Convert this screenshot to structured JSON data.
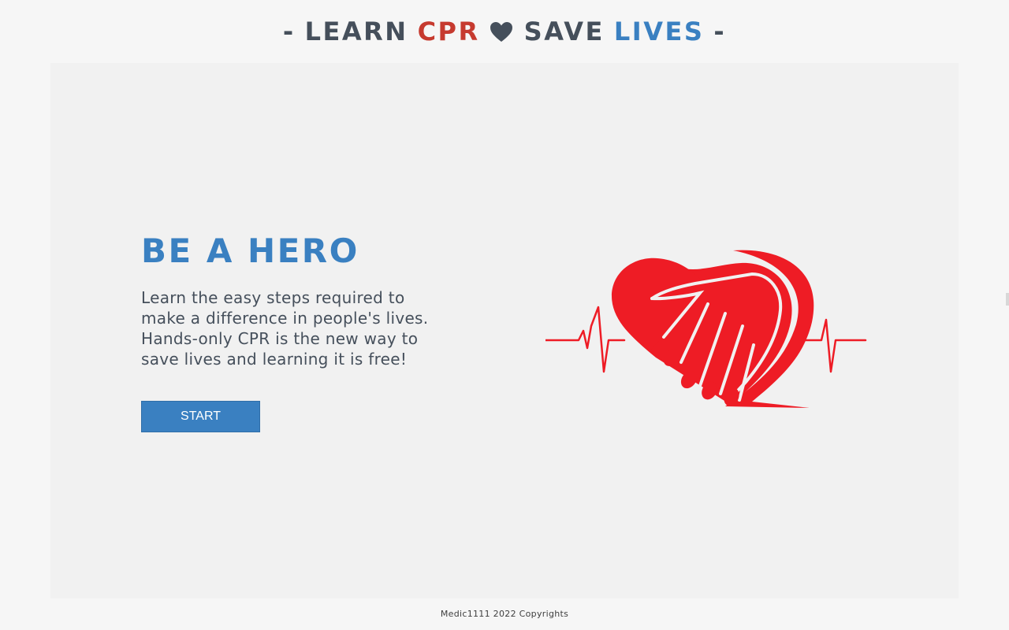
{
  "header": {
    "dash_left": "-",
    "word_learn": "LEARN",
    "word_cpr": "CPR",
    "heart_icon": "heart-icon",
    "word_save": "SAVE",
    "word_lives": "LIVES",
    "dash_right": "-"
  },
  "hero": {
    "title": "BE A HERO",
    "description_lines": [
      "Learn the easy steps required to",
      "make a difference in people's lives.",
      "Hands-only CPR is the new way to",
      "save lives and learning it is free!"
    ],
    "start_label": "START",
    "illustration_icon": "heart-hand-heartbeat-icon"
  },
  "footer": {
    "copyright": "Medic1111 2022 Copyrights"
  },
  "colors": {
    "accent_blue": "#3a80c1",
    "accent_red": "#c63a2f",
    "illustration_red": "#ee1c25",
    "text_dark": "#454f5b",
    "page_bg": "#f6f6f6",
    "card_bg": "#f1f1f1"
  }
}
